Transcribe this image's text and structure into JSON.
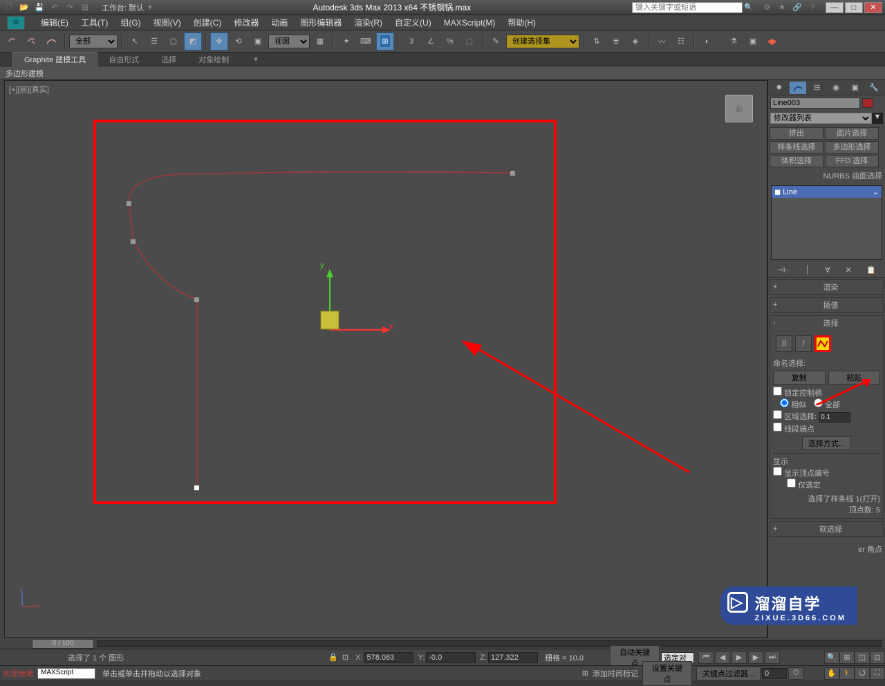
{
  "title_bar": {
    "workspace_label": "工作台: 默认",
    "app_title": "Autodesk 3ds Max  2013 x64    不锈钢锅.max",
    "search_placeholder": "键入关键字或短语"
  },
  "menu": {
    "items": [
      "编辑(E)",
      "工具(T)",
      "组(G)",
      "视图(V)",
      "创建(C)",
      "修改器",
      "动画",
      "图形编辑器",
      "渲染(R)",
      "自定义(U)",
      "MAXScript(M)",
      "帮助(H)"
    ]
  },
  "toolbar": {
    "filter_all": "全部",
    "ref_system": "视图",
    "named_sel_placeholder": "创建选择集"
  },
  "ribbon": {
    "tabs": [
      "Graphite 建模工具",
      "自由形式",
      "选择",
      "对象绘制"
    ],
    "panel_label": "多边形建模"
  },
  "viewport": {
    "label": "[+][前][真实]",
    "axis_x": "x",
    "axis_y": "y",
    "viewcube_face": "前"
  },
  "right_panel": {
    "object_name": "Line003",
    "modifier_list_label": "修改器列表",
    "mod_buttons": [
      "挤出",
      "面片选择",
      "样条线选择",
      "多边形选择",
      "体积选择",
      "FFD 选择"
    ],
    "mod_extra": "NURBS 曲面选择",
    "stack_item": "Line",
    "rollouts": {
      "render": "渲染",
      "interp": "插值",
      "selection": "选择",
      "softsel": "软选择"
    },
    "selection": {
      "named_sel_label": "命名选择:",
      "copy_btn": "复制",
      "paste_btn": "粘贴",
      "lock_handles": "锁定控制柄",
      "radio_similar": "相似",
      "radio_all": "全部",
      "area_sel": "区域选择:",
      "area_val": "0.1",
      "seg_end": "线段端点",
      "select_by": "选择方式...",
      "display_label": "显示",
      "show_vertex_num": "显示顶点编号",
      "only_sel": "仅选定",
      "sel_info": "选择了样条线 1(打开)",
      "vertex_count": "顶点数: 5"
    },
    "softsel_body": "er 角点"
  },
  "timeline": {
    "slider": "0 / 100"
  },
  "status": {
    "welcome": "欢迎使用",
    "maxscript": "MAXScript",
    "sel_count_row": "选择了 1 个 图形",
    "prompt": "单击或单击并拖动以选择对象",
    "x_val": "578.083",
    "y_val": "-0.0",
    "z_val": "127.322",
    "grid_label": "栅格 = 10.0",
    "autokey": "自动关键点",
    "setkey": "设置关键点",
    "sel_lock": "选定对",
    "add_time_tag": "添加时间标记",
    "key_filter": "关键点过滤器..."
  },
  "watermark": {
    "text": "溜溜自学",
    "sub": "ZIXUE.3D66.COM"
  }
}
